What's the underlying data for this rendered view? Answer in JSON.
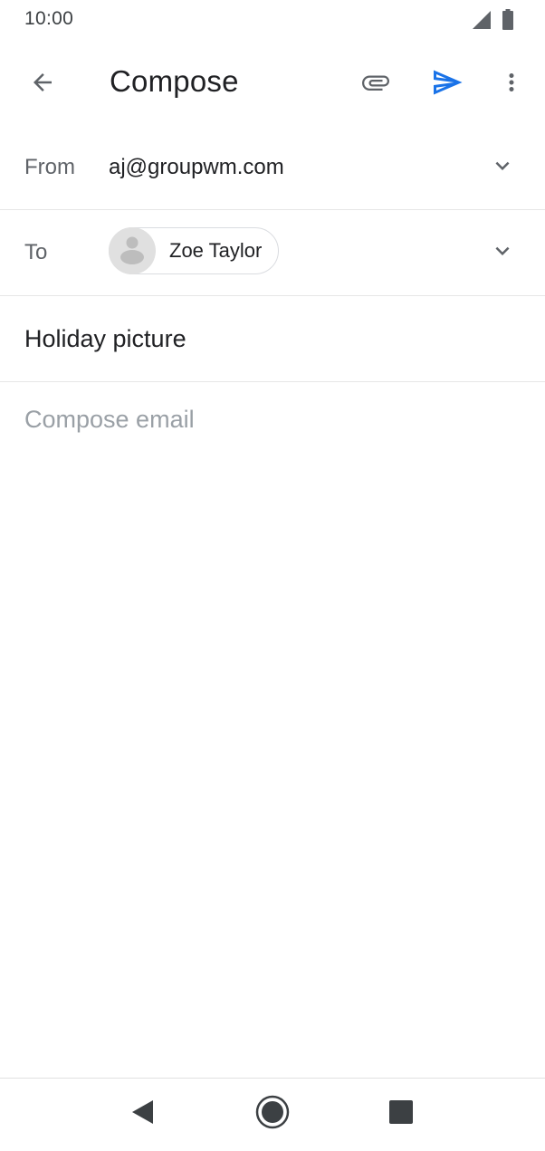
{
  "status_bar": {
    "time": "10:00",
    "signal_icon": "cellular-signal-icon",
    "battery_icon": "battery-icon"
  },
  "app_bar": {
    "title": "Compose",
    "back_icon": "arrow-back-icon",
    "attach_icon": "paperclip-icon",
    "send_icon": "send-icon",
    "more_icon": "more-vertical-icon",
    "send_color": "#1a73e8"
  },
  "from_field": {
    "label": "From",
    "value": "aj@groupwm.com"
  },
  "to_field": {
    "label": "To",
    "recipient_name": "Zoe Taylor"
  },
  "subject_field": {
    "value": "Holiday picture"
  },
  "body_field": {
    "placeholder": "Compose email"
  },
  "nav_bar": {
    "back_icon": "nav-back-triangle-icon",
    "home_icon": "nav-home-circle-icon",
    "recents_icon": "nav-recents-square-icon"
  }
}
